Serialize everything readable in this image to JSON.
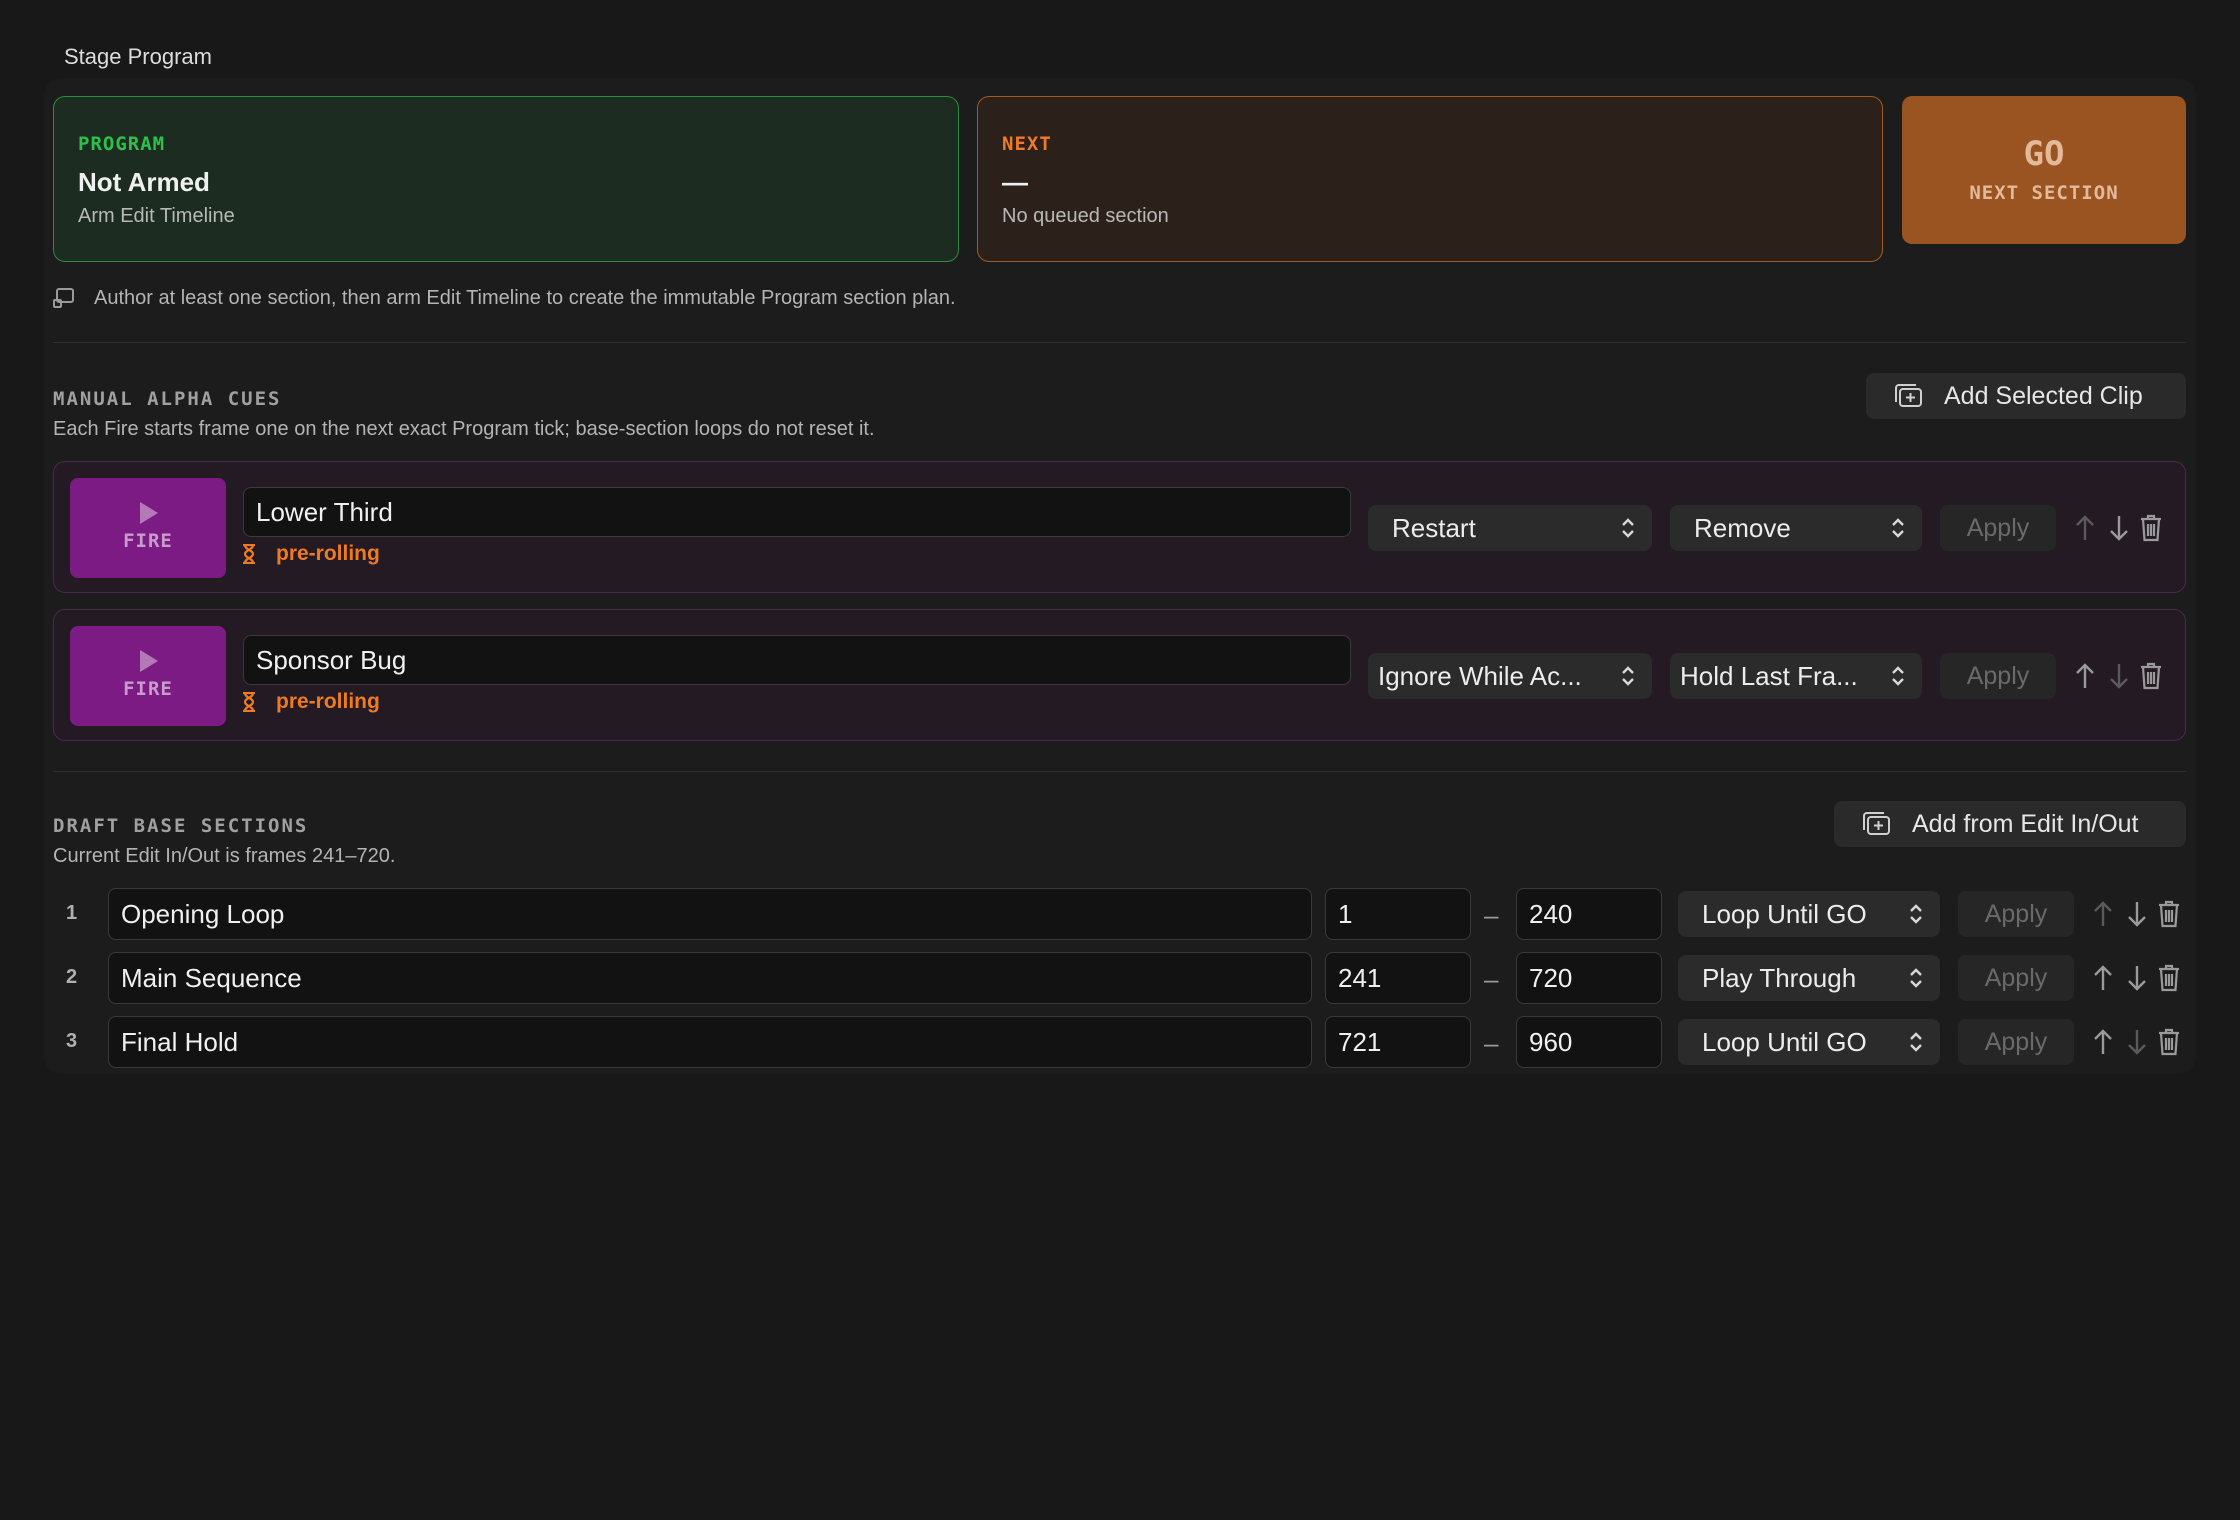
{
  "window_title": "Stage Program",
  "program_card": {
    "kicker": "PROGRAM",
    "title": "Not Armed",
    "subtitle": "Arm Edit Timeline"
  },
  "next_card": {
    "kicker": "NEXT",
    "title": "—",
    "subtitle": "No queued section"
  },
  "go_button": {
    "label": "GO",
    "sublabel": "NEXT SECTION"
  },
  "hint": "Author at least one section, then arm Edit Timeline to create the immutable Program section plan.",
  "manual_cues": {
    "heading": "MANUAL ALPHA CUES",
    "description": "Each Fire starts frame one on the next exact Program tick; base-section loops do not reset it.",
    "add_button": "Add Selected Clip",
    "items": [
      {
        "fire_label": "FIRE",
        "name": "Lower Third",
        "status": "pre-rolling",
        "retrigger": "Restart",
        "end_action": "Remove",
        "apply": "Apply"
      },
      {
        "fire_label": "FIRE",
        "name": "Sponsor Bug",
        "status": "pre-rolling",
        "retrigger": "Ignore While Ac...",
        "end_action": "Hold Last Fra...",
        "apply": "Apply"
      }
    ]
  },
  "draft_sections": {
    "heading": "DRAFT BASE SECTIONS",
    "description": "Current Edit In/Out is frames 241–720.",
    "add_button": "Add from Edit In/Out",
    "separator": "–",
    "items": [
      {
        "num": "1",
        "name": "Opening Loop",
        "start": "1",
        "end": "240",
        "mode": "Loop Until GO",
        "apply": "Apply"
      },
      {
        "num": "2",
        "name": "Main Sequence",
        "start": "241",
        "end": "720",
        "mode": "Play Through",
        "apply": "Apply"
      },
      {
        "num": "3",
        "name": "Final Hold",
        "start": "721",
        "end": "960",
        "mode": "Loop Until GO",
        "apply": "Apply"
      }
    ]
  },
  "icons": [
    "monitor-icon",
    "add-clip-icon",
    "play-icon",
    "hourglass-icon",
    "chevron-updown-icon",
    "arrow-up-icon",
    "arrow-down-icon",
    "trash-icon"
  ],
  "colors": {
    "program_green": "#2ec04a",
    "next_orange": "#f07a2a",
    "go_bg": "#9a5421",
    "fire_purple": "#7c1b84",
    "prerolling_orange": "#ee7a22"
  }
}
